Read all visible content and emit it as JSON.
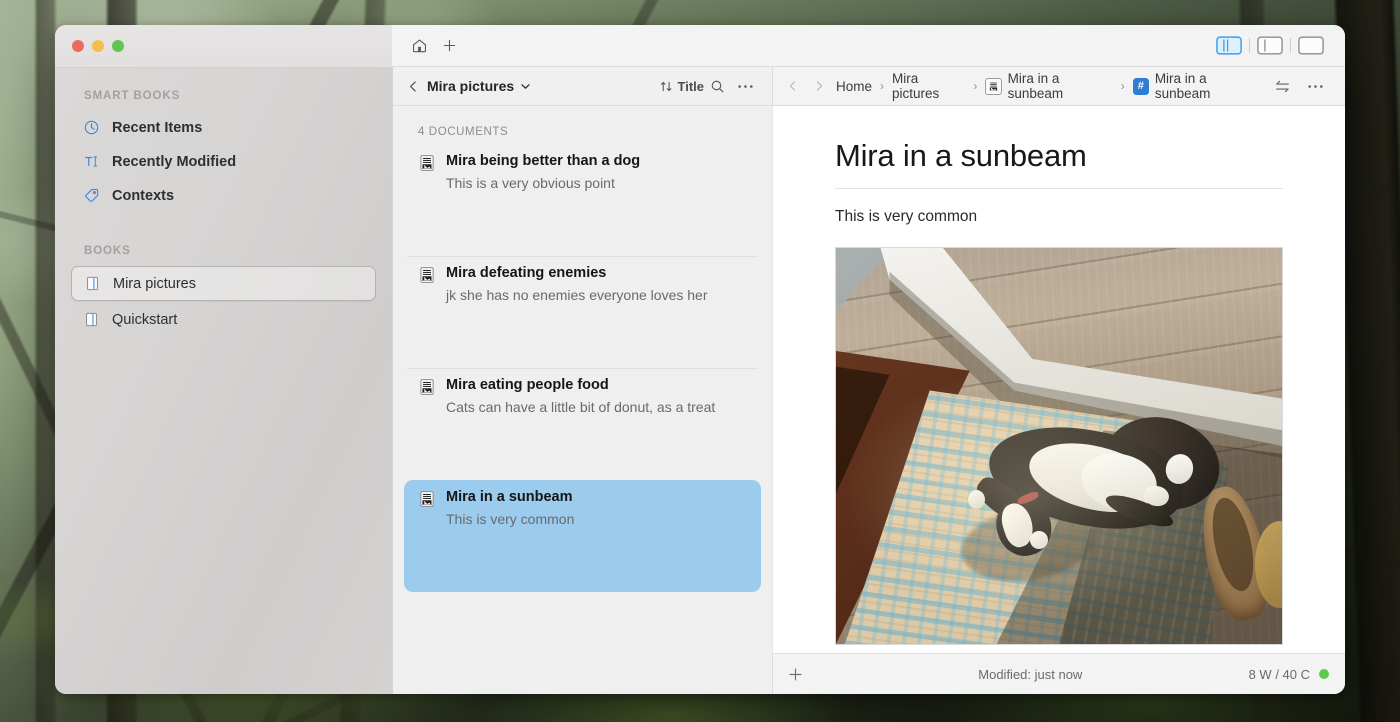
{
  "window": {
    "traffic_lights": [
      {
        "name": "close",
        "color": "#ed6a5e"
      },
      {
        "name": "minimize",
        "color": "#f4bd4f"
      },
      {
        "name": "zoom",
        "color": "#61c554"
      }
    ],
    "toolbar": {
      "home_icon": "home-icon",
      "new_icon": "plus-icon",
      "panel_toggles": [
        {
          "name": "toggle-sidebar",
          "icon": "panel-left-split-icon",
          "active": true
        },
        {
          "name": "toggle-list",
          "icon": "panel-left-icon",
          "active": false
        },
        {
          "name": "toggle-editor",
          "icon": "panel-full-icon",
          "active": false
        }
      ]
    }
  },
  "sidebar": {
    "sections": [
      {
        "header": "SMART BOOKS",
        "items": [
          {
            "label": "Recent Items",
            "icon": "clock-icon",
            "selected": false
          },
          {
            "label": "Recently Modified",
            "icon": "text-cursor-icon",
            "selected": false
          },
          {
            "label": "Contexts",
            "icon": "tag-icon",
            "selected": false
          }
        ]
      },
      {
        "header": "BOOKS",
        "items": [
          {
            "label": "Mira pictures",
            "icon": "book-icon",
            "selected": true
          },
          {
            "label": "Quickstart",
            "icon": "book-icon",
            "selected": false
          }
        ]
      }
    ]
  },
  "list": {
    "toolbar": {
      "back_icon": "chevron-left-icon",
      "title": "Mira pictures",
      "title_chevron": "chevron-down-icon",
      "sort_icon": "sort-arrows-icon",
      "sort_label": "Title",
      "search_icon": "search-icon",
      "more_icon": "ellipsis-icon"
    },
    "count_label": "4 DOCUMENTS",
    "documents": [
      {
        "title": "Mira being better than a dog",
        "subtitle": "This is a very obvious point",
        "icon": "document-image-icon",
        "selected": false
      },
      {
        "title": "Mira defeating enemies",
        "subtitle": "jk she has no enemies everyone loves her",
        "icon": "document-image-icon",
        "selected": false
      },
      {
        "title": "Mira eating people food",
        "subtitle": "Cats can have a little bit of donut, as a treat",
        "icon": "document-image-icon",
        "selected": false
      },
      {
        "title": "Mira in a sunbeam",
        "subtitle": "This is very common",
        "icon": "document-image-icon",
        "selected": true
      }
    ]
  },
  "editor": {
    "breadcrumb": {
      "back_icon": "chevron-left-icon",
      "forward_icon": "chevron-right-icon",
      "items": [
        {
          "label": "Home",
          "icon": null
        },
        {
          "label": "Mira pictures",
          "icon": null
        },
        {
          "label": "Mira in a sunbeam",
          "icon": "document-image-icon"
        },
        {
          "label": "Mira in a sunbeam",
          "icon": "hash-badge-icon"
        }
      ],
      "separator": "›",
      "swap_icon": "swap-arrows-icon",
      "more_icon": "ellipsis-icon"
    },
    "title": "Mira in a sunbeam",
    "paragraph": "This is very common",
    "image_alt": "Tuxedo cat lying on a patterned rug in a sunbeam by a sliding glass door"
  },
  "status": {
    "add_icon": "plus-icon",
    "modified": "Modified: just now",
    "counts": "8 W / 40 C",
    "indicator_color": "#5fc94f"
  },
  "colors": {
    "selection_blue": "#9bcbed",
    "accent_blue": "#2f7cd6",
    "sidebar_bg": "#d6d4d3",
    "list_bg": "#efefef",
    "editor_bg": "#ffffff"
  }
}
